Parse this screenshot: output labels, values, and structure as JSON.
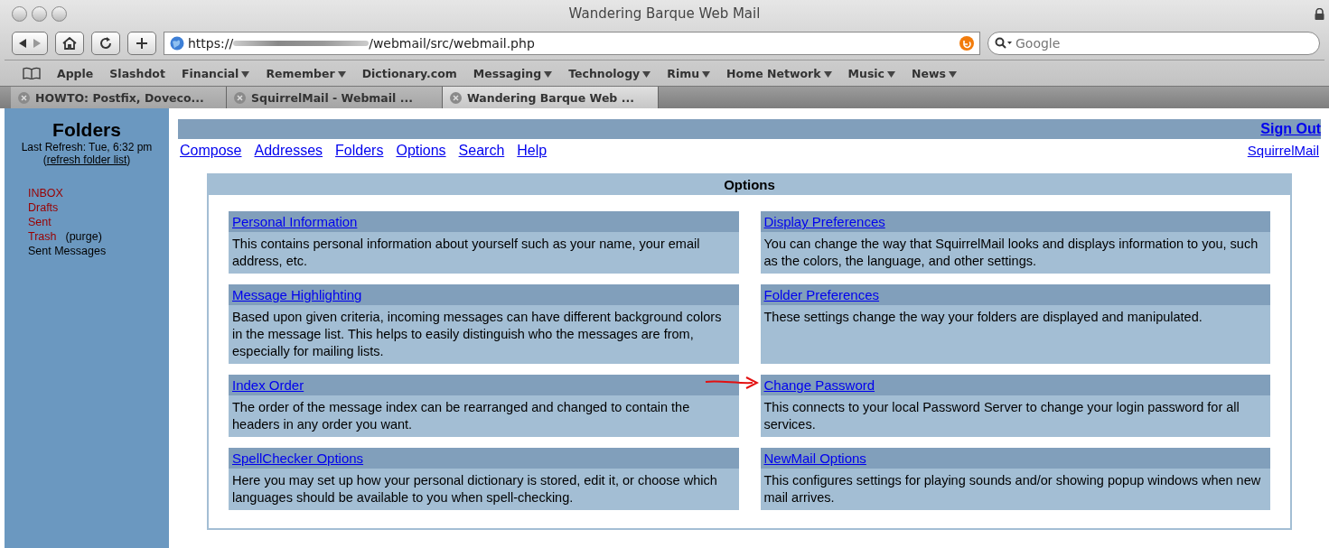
{
  "window": {
    "title": "Wandering Barque Web Mail"
  },
  "address_bar": {
    "scheme": "https://",
    "path": "/webmail/src/webmail.php"
  },
  "search": {
    "placeholder": "Google"
  },
  "bookmarks": [
    {
      "label": "Apple",
      "menu": false
    },
    {
      "label": "Slashdot",
      "menu": false
    },
    {
      "label": "Financial",
      "menu": true
    },
    {
      "label": "Remember",
      "menu": true
    },
    {
      "label": "Dictionary.com",
      "menu": false
    },
    {
      "label": "Messaging",
      "menu": true
    },
    {
      "label": "Technology",
      "menu": true
    },
    {
      "label": "Rimu",
      "menu": true
    },
    {
      "label": "Home Network",
      "menu": true
    },
    {
      "label": "Music",
      "menu": true
    },
    {
      "label": "News",
      "menu": true
    }
  ],
  "tabs": [
    {
      "label": "HOWTO: Postfix, Doveco...",
      "selected": false
    },
    {
      "label": "SquirrelMail - Webmail ...",
      "selected": false
    },
    {
      "label": "Wandering Barque Web ...",
      "selected": true
    }
  ],
  "sidebar": {
    "title": "Folders",
    "refresh": "Last Refresh: Tue, 6:32 pm",
    "refresh_link_before": "(",
    "refresh_link": "refresh folder list",
    "refresh_link_after": ")",
    "folders": [
      {
        "name": "INBOX",
        "color": "#990000"
      },
      {
        "name": "Drafts",
        "color": "#990000"
      },
      {
        "name": "Sent",
        "color": "#990000"
      },
      {
        "name": "Trash",
        "color": "#990000",
        "action": "(purge)"
      },
      {
        "name": "Sent Messages",
        "color": "#000000"
      }
    ]
  },
  "top_bar": {
    "sign_out": "Sign Out"
  },
  "nav": [
    "Compose",
    "Addresses",
    "Folders",
    "Options",
    "Search",
    "Help"
  ],
  "brand_link": "SquirrelMail",
  "options": {
    "title": "Options",
    "items": [
      {
        "title": "Personal Information",
        "description": "This contains personal information about yourself such as your name, your email address, etc.",
        "annotated": false
      },
      {
        "title": "Display Preferences",
        "description": "You can change the way that SquirrelMail looks and displays information to you, such as the colors, the language, and other settings.",
        "annotated": false
      },
      {
        "title": "Message Highlighting",
        "description": "Based upon given criteria, incoming messages can have different background colors in the message list. This helps to easily distinguish who the messages are from, especially for mailing lists.",
        "annotated": false
      },
      {
        "title": "Folder Preferences",
        "description": "These settings change the way your folders are displayed and manipulated.",
        "annotated": false
      },
      {
        "title": "Index Order",
        "description": "The order of the message index can be rearranged and changed to contain the headers in any order you want.",
        "annotated": false
      },
      {
        "title": "Change Password",
        "description": "This connects to your local Password Server to change your login password for all services.",
        "annotated": true
      },
      {
        "title": "SpellChecker Options",
        "description": "Here you may set up how your personal dictionary is stored, edit it, or choose which languages should be available to you when spell-checking.",
        "annotated": false
      },
      {
        "title": "NewMail Options",
        "description": "This configures settings for playing sounds and/or showing popup windows when new mail arrives.",
        "annotated": false
      }
    ]
  }
}
